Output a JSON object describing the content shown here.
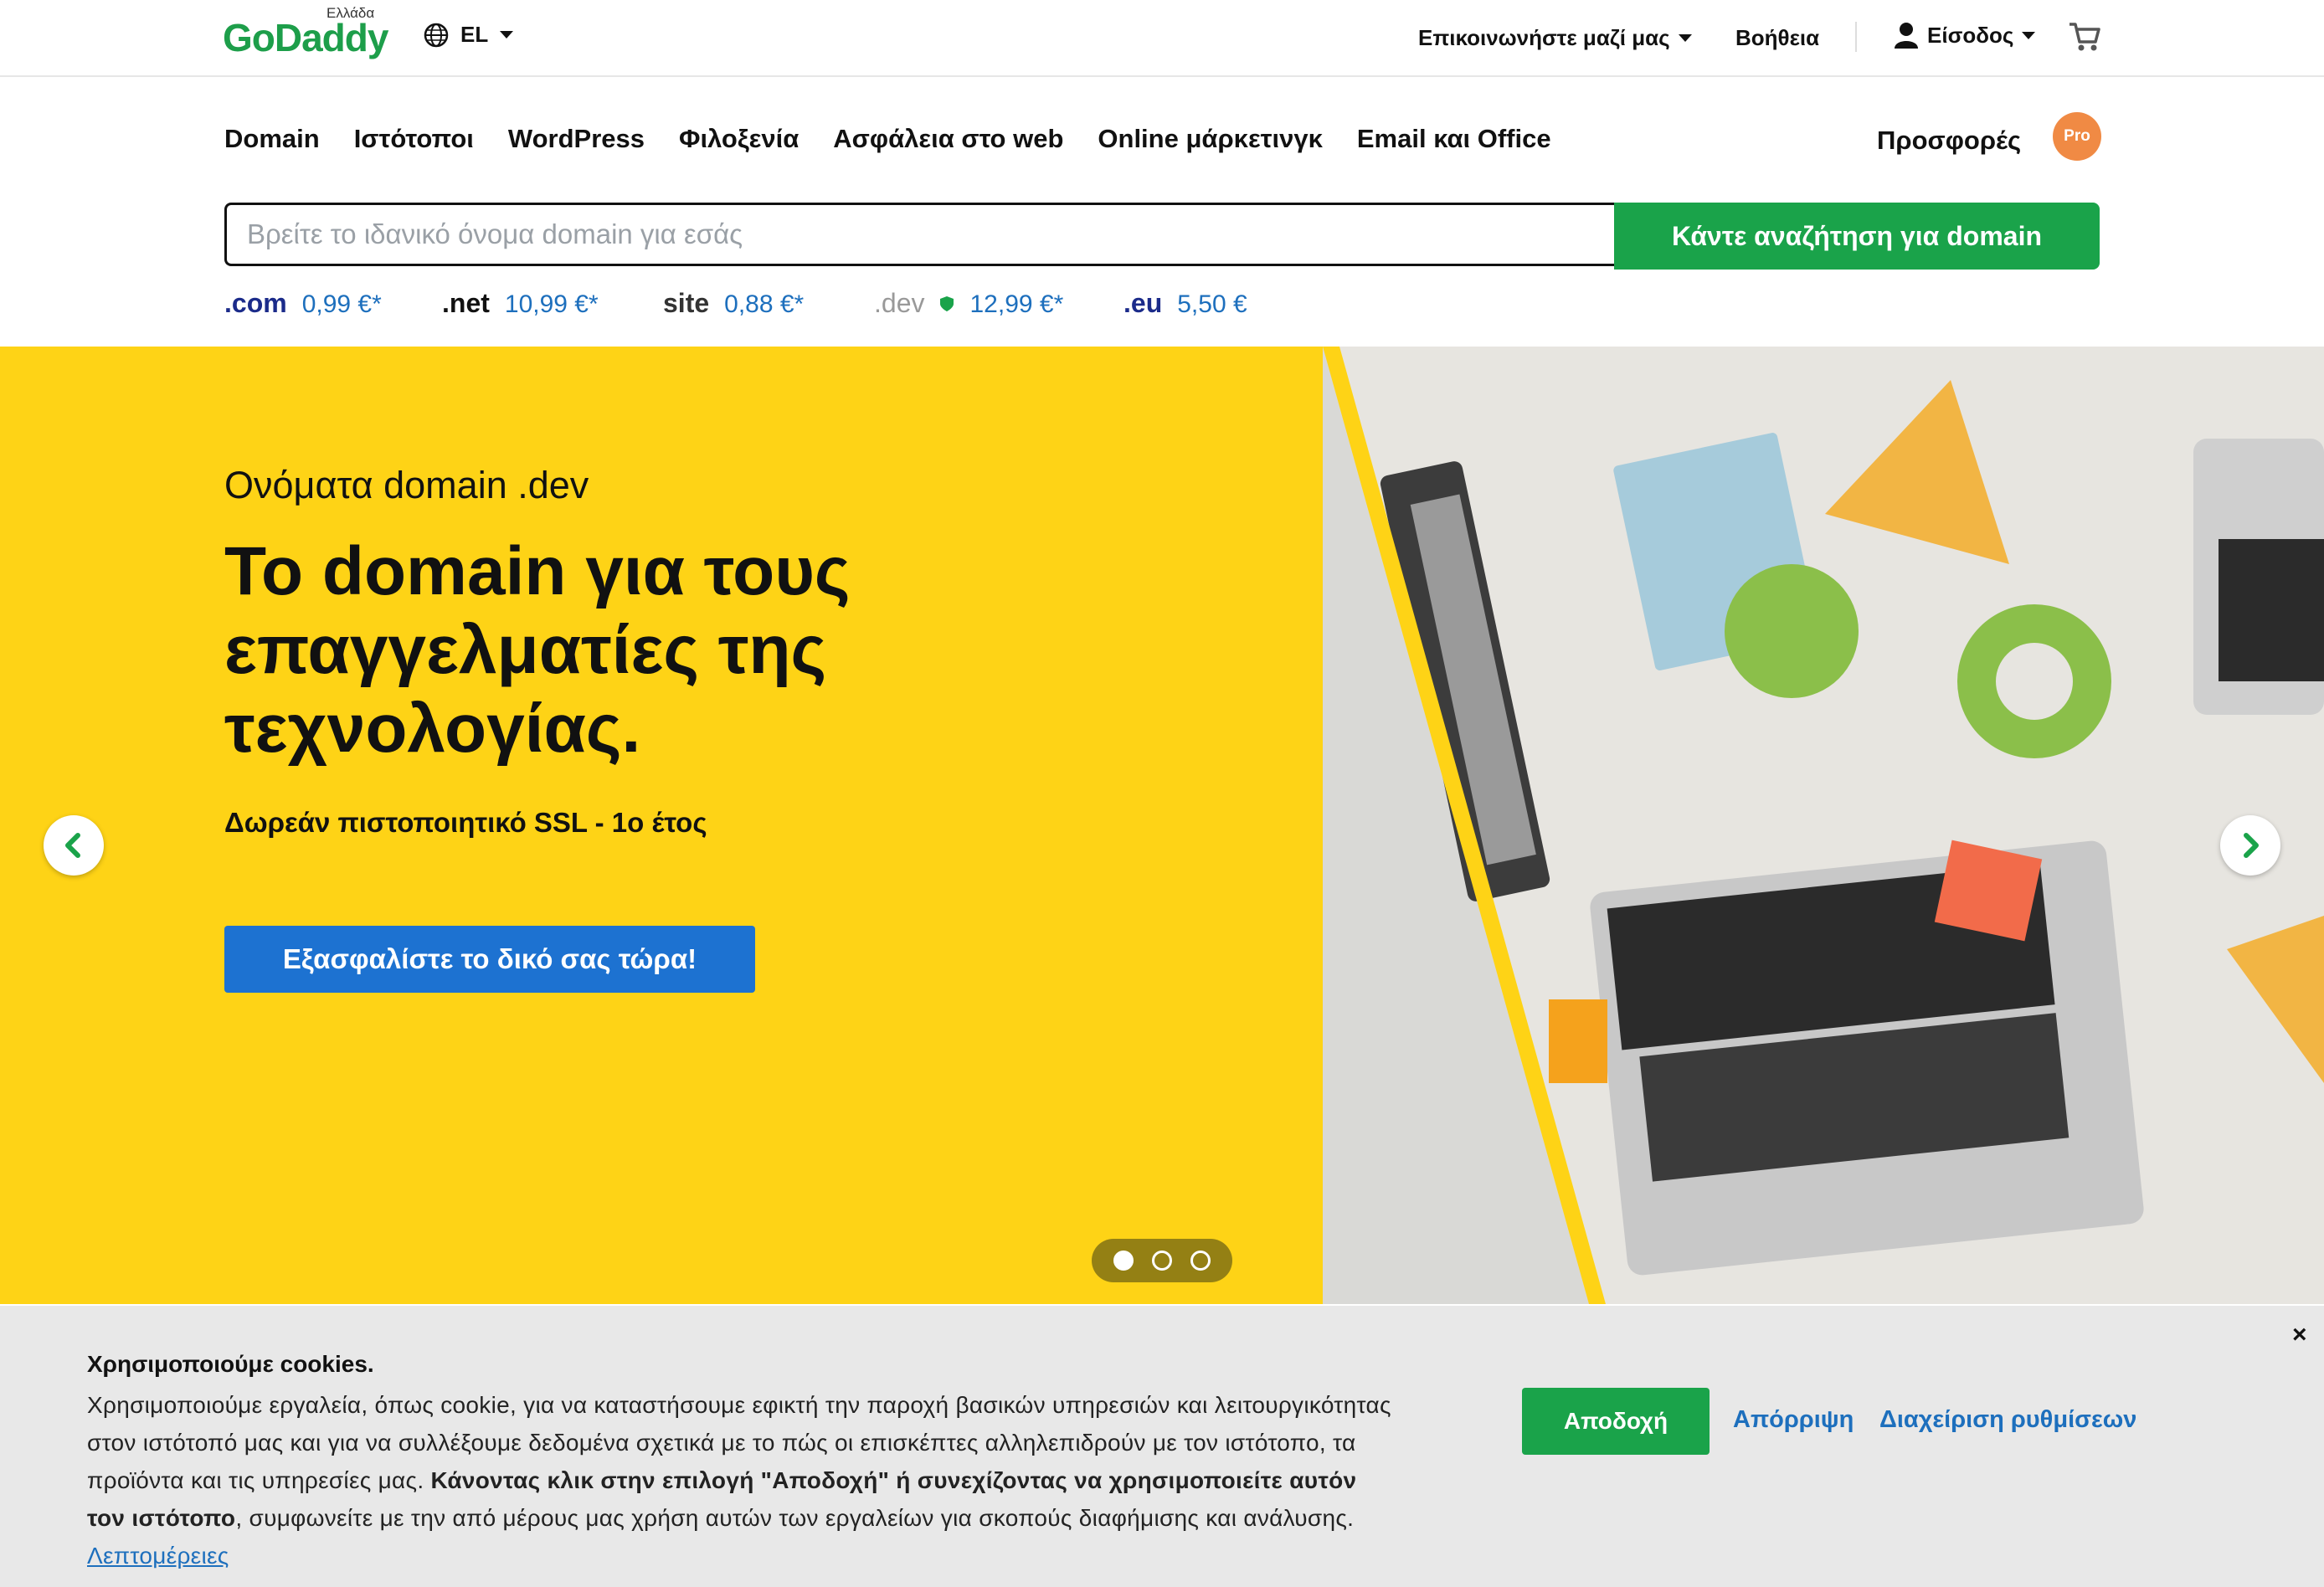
{
  "header": {
    "logo": "GoDaddy",
    "region": "Ελλάδα",
    "language": "EL",
    "contact": "Επικοινωνήστε μαζί μας",
    "help": "Βοήθεια",
    "signin": "Είσοδος"
  },
  "nav": {
    "items": [
      "Domain",
      "Ιστότοποι",
      "WordPress",
      "Φιλοξενία",
      "Ασφάλεια στο web",
      "Online μάρκετινγκ",
      "Email και Office"
    ],
    "promo": "Προσφορές",
    "pro_badge": "Pro"
  },
  "search": {
    "placeholder": "Βρείτε το ιδανικό όνομα domain για εσάς",
    "button": "Κάντε αναζήτηση για domain"
  },
  "tlds": [
    {
      "name": ".com",
      "price": "0,99 €*"
    },
    {
      "name": ".net",
      "price": "10,99 €*"
    },
    {
      "name": "site",
      "price": "0,88 €*"
    },
    {
      "name": ".dev",
      "price": "12,99 €*"
    },
    {
      "name": ".eu",
      "price": "5,50 €"
    }
  ],
  "hero": {
    "eyebrow": "Ονόματα domain .dev",
    "headline": "Το domain για τους επαγγελματίες της τεχνολογίας.",
    "subline": "Δωρεάν πιστοποιητικό SSL - 1ο έτος",
    "cta": "Εξασφαλίστε το δικό σας τώρα!",
    "slide_count": 3,
    "active_slide": 1,
    "bg_color": "#fed316"
  },
  "cookie": {
    "title": "Χρησιμοποιούμε cookies.",
    "text_plain": "Χρησιμοποιούμε εργαλεία, όπως cookie, για να καταστήσουμε εφικτή την παροχή βασικών υπηρεσιών και λειτουργικότητας στον ιστότοπό μας και για να συλλέξουμε δεδομένα σχετικά με το πώς οι επισκέπτες αλληλεπιδρούν με τον ιστότοπο, τα προϊόντα και τις υπηρεσίες μας.",
    "text_bold": "Κάνοντας κλικ στην επιλογή \"Αποδοχή\" ή συνεχίζοντας να χρησιμοποιείτε αυτόν τον ιστότοπο",
    "text_end": ", συμφωνείτε με την από μέρους μας χρήση αυτών των εργαλείων για σκοπούς διαφήμισης και ανάλυσης.",
    "link": "Λεπτομέρειες",
    "accept": "Αποδοχή",
    "reject": "Απόρριψη",
    "manage": "Διαχείριση ρυθμίσεων",
    "close": "×"
  }
}
